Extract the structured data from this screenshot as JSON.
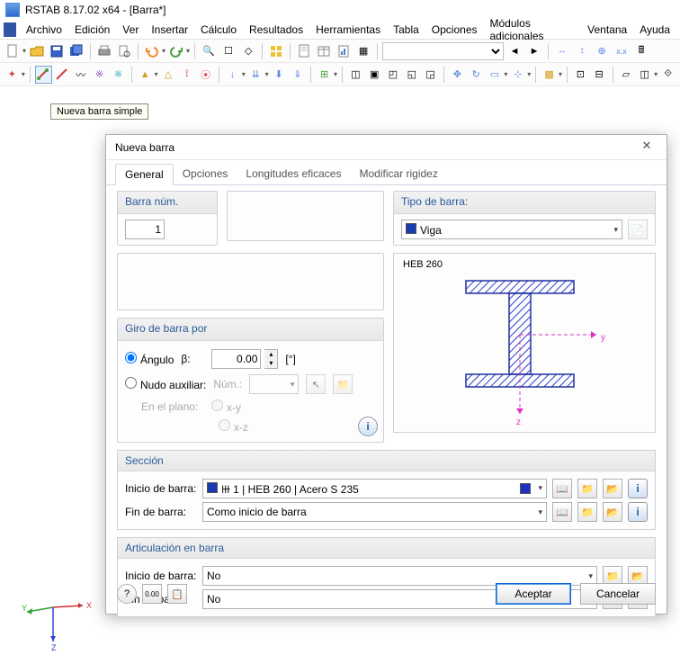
{
  "app_title": "RSTAB 8.17.02 x64 - [Barra*]",
  "menu": [
    "Archivo",
    "Edición",
    "Ver",
    "Insertar",
    "Cálculo",
    "Resultados",
    "Herramientas",
    "Tabla",
    "Opciones",
    "Módulos adicionales",
    "Ventana",
    "Ayuda"
  ],
  "tooltip": "Nueva barra simple",
  "dialog": {
    "title": "Nueva barra",
    "tabs": [
      "General",
      "Opciones",
      "Longitudes eficaces",
      "Modificar rigidez"
    ],
    "active_tab": 0,
    "barra_num": {
      "label": "Barra núm.",
      "value": "1"
    },
    "tipo_barra": {
      "label": "Tipo de barra:",
      "value": "Viga"
    },
    "preview_label": "HEB 260",
    "giro": {
      "label": "Giro de barra por",
      "angulo": "Ángulo",
      "beta": "β:",
      "beta_value": "0.00",
      "beta_unit": "[°]",
      "nudo": "Nudo auxiliar:",
      "num": "Núm.:",
      "en_plano": "En el plano:",
      "xy": "x-y",
      "xz": "x-z"
    },
    "seccion": {
      "label": "Sección",
      "inicio_label": "Inicio de barra:",
      "inicio_value": "1  |  HEB 260  |  Acero S 235",
      "fin_label": "Fin de barra:",
      "fin_value": "Como inicio de barra"
    },
    "articulacion": {
      "label": "Articulación en barra",
      "inicio_label": "Inicio de barra:",
      "inicio_value": "No",
      "fin_label": "Fin de barra:",
      "fin_value": "No"
    },
    "buttons": {
      "ok": "Aceptar",
      "cancel": "Cancelar"
    }
  }
}
